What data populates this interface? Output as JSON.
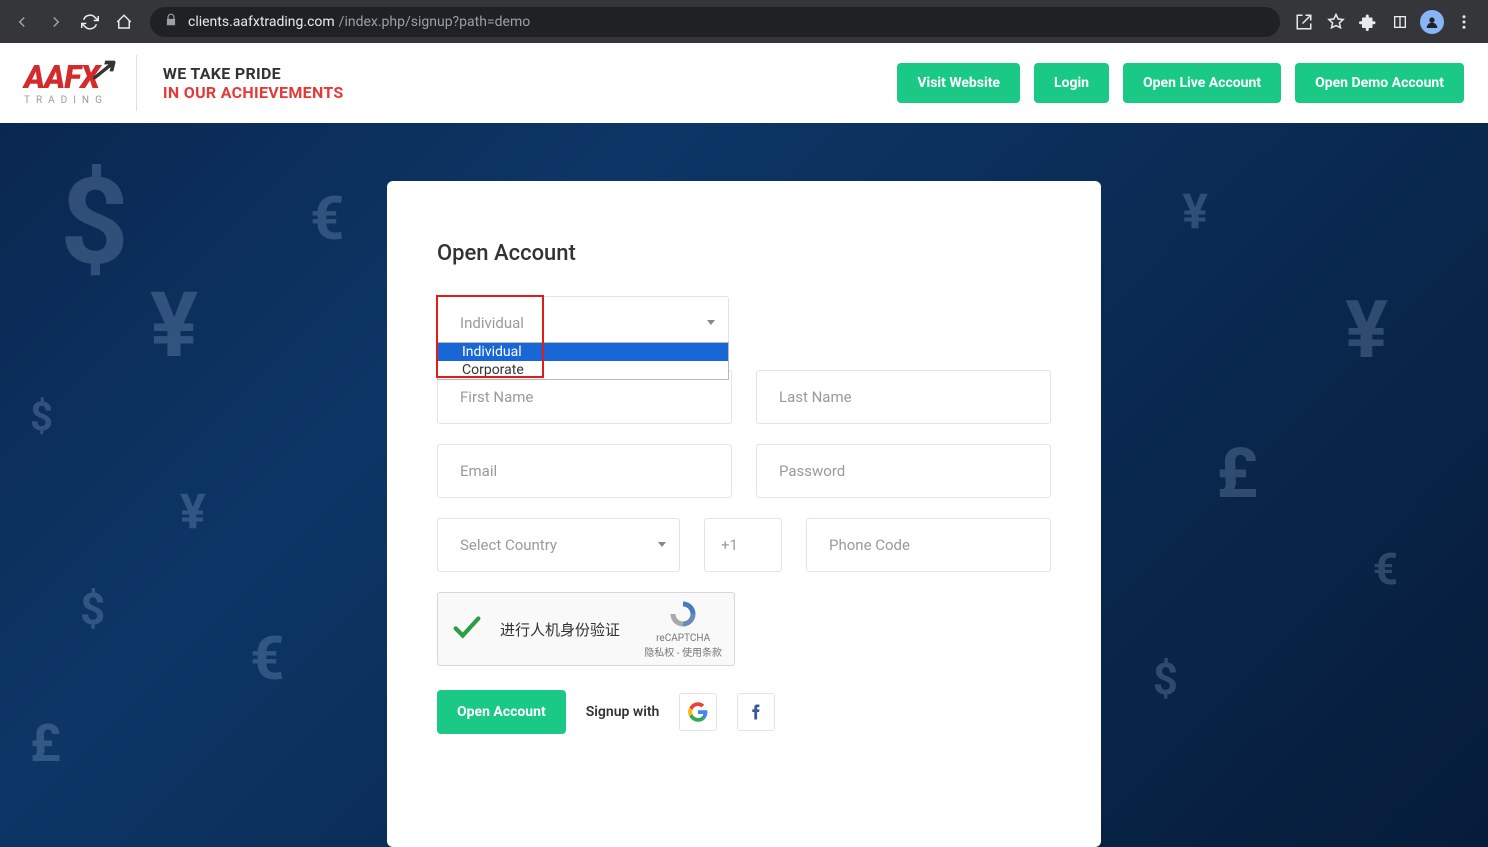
{
  "browser": {
    "url_host": "clients.aafxtrading.com",
    "url_path": "/index.php/signup?path=demo"
  },
  "logo": {
    "brand": "AAFX",
    "sub": "TRADING"
  },
  "tagline": {
    "line1": "WE TAKE PRIDE",
    "line2": "IN OUR ACHIEVEMENTS"
  },
  "nav": {
    "visit": "Visit Website",
    "login": "Login",
    "open_live": "Open Live Account",
    "open_demo": "Open Demo Account"
  },
  "form": {
    "title": "Open Account",
    "account_type_value": "Individual",
    "account_type_options": {
      "0": "Individual",
      "1": "Corporate"
    },
    "first_name_ph": "First Name",
    "last_name_ph": "Last Name",
    "email_ph": "Email",
    "password_ph": "Password",
    "country_ph": "Select Country",
    "phone_cc": "+1",
    "phone_ph": "Phone Code",
    "captcha_label": "进行人机身份验证",
    "captcha_brand": "reCAPTCHA",
    "captcha_terms": "隐私权 - 使用条款",
    "submit": "Open Account",
    "signup_with": "Signup with"
  }
}
